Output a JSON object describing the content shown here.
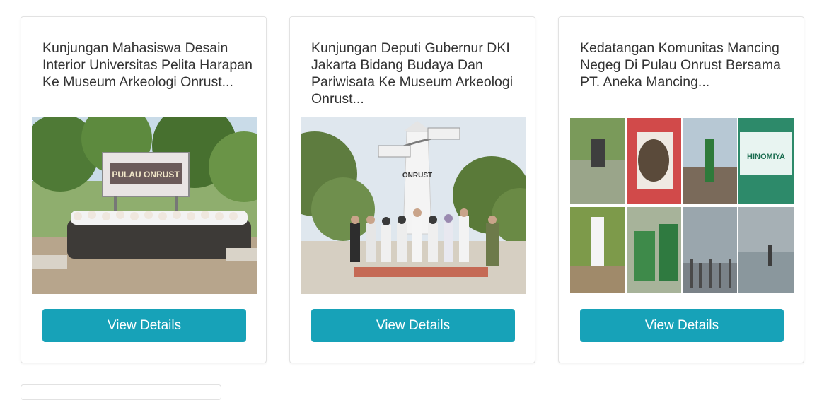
{
  "cards": [
    {
      "title": "Kunjungan Mahasiswa Desain Interior Universitas Pelita Harapan Ke Museum Arkeologi Onrust...",
      "button_label": "View Details",
      "image_sign_text": "PULAU ONRUST"
    },
    {
      "title": "Kunjungan Deputi Gubernur DKI Jakarta Bidang Budaya Dan Pariwisata Ke Museum Arkeologi Onrust...",
      "button_label": "View Details",
      "image_sign_text": "ONRUST"
    },
    {
      "title": "Kedatangan Komunitas Mancing Negeg Di Pulau Onrust Bersama PT. Aneka Mancing...",
      "button_label": "View Details",
      "image_sign_text": "HINOMIYA"
    }
  ],
  "colors": {
    "button": "#17a2b8",
    "title": "#333333",
    "border": "#e2e2e2"
  }
}
